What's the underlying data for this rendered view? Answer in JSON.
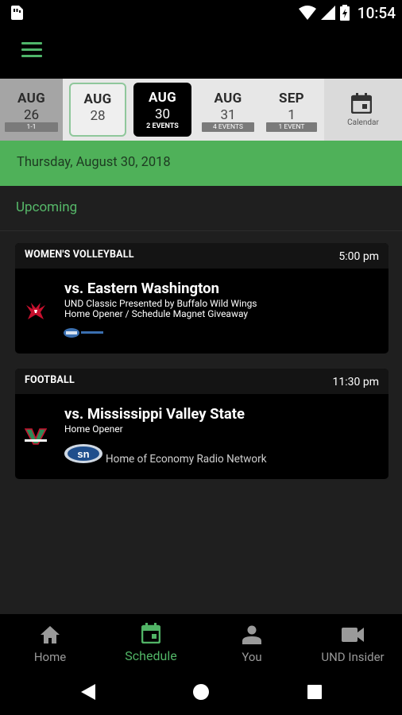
{
  "status": {
    "time": "10:54"
  },
  "dates": [
    {
      "month": "AUG",
      "day": "26",
      "badge": "1-1"
    },
    {
      "month": "AUG",
      "day": "28",
      "badge": ""
    },
    {
      "month": "AUG",
      "day": "30",
      "badge": "2 EVENTS"
    },
    {
      "month": "AUG",
      "day": "31",
      "badge": "4 EVENTS"
    },
    {
      "month": "SEP",
      "day": "1",
      "badge": "1 EVENT"
    }
  ],
  "calendar_label": "Calendar",
  "selected_date": "Thursday, August 30, 2018",
  "section_label": "Upcoming",
  "events": [
    {
      "sport": "WOMEN'S VOLLEYBALL",
      "time": "5:00 pm",
      "opponent": "vs. Eastern Washington",
      "notes": [
        "UND Classic Presented by Buffalo Wild Wings",
        "Home Opener / Schedule Magnet Giveaway"
      ],
      "tv_text": ""
    },
    {
      "sport": "FOOTBALL",
      "time": "11:30 pm",
      "opponent": "vs. Mississippi Valley State",
      "notes": [
        "Home Opener"
      ],
      "tv_text": "Home of Economy Radio Network"
    }
  ],
  "tabs": [
    {
      "label": "Home",
      "icon": "home-icon"
    },
    {
      "label": "Schedule",
      "icon": "calendar-icon"
    },
    {
      "label": "You",
      "icon": "person-icon"
    },
    {
      "label": "UND Insider",
      "icon": "video-icon"
    }
  ],
  "colors": {
    "accent": "#4fb159",
    "background": "#1f1f1f",
    "card": "#000000"
  }
}
